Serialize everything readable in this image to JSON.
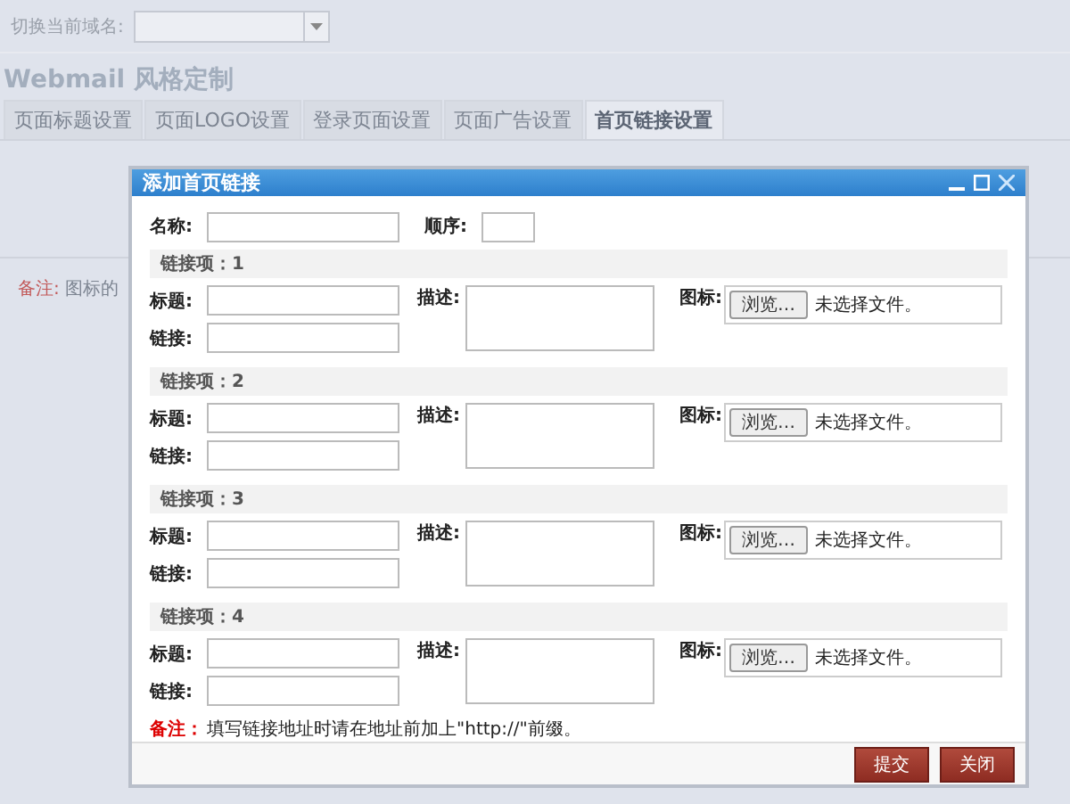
{
  "page": {
    "domain_label": "切换当前域名:",
    "title": "Webmail 风格定制",
    "tabs": [
      {
        "label": "页面标题设置",
        "selected": false
      },
      {
        "label": "页面LOGO设置",
        "selected": false
      },
      {
        "label": "登录页面设置",
        "selected": false
      },
      {
        "label": "页面广告设置",
        "selected": false
      },
      {
        "label": "首页链接设置",
        "selected": true
      }
    ],
    "note": {
      "label": "备注:",
      "text": "图标的"
    }
  },
  "dialog": {
    "title": "添加首页链接",
    "name_label": "名称:",
    "order_label": "顺序:",
    "groups": [
      {
        "heading": "链接项：1",
        "title_label": "标题:",
        "link_label": "链接:",
        "desc_label": "描述:",
        "icon_label": "图标:",
        "browse": "浏览…",
        "file_status": "未选择文件。"
      },
      {
        "heading": "链接项：2",
        "title_label": "标题:",
        "link_label": "链接:",
        "desc_label": "描述:",
        "icon_label": "图标:",
        "browse": "浏览…",
        "file_status": "未选择文件。"
      },
      {
        "heading": "链接项：3",
        "title_label": "标题:",
        "link_label": "链接:",
        "desc_label": "描述:",
        "icon_label": "图标:",
        "browse": "浏览…",
        "file_status": "未选择文件。"
      },
      {
        "heading": "链接项：4",
        "title_label": "标题:",
        "link_label": "链接:",
        "desc_label": "描述:",
        "icon_label": "图标:",
        "browse": "浏览…",
        "file_status": "未选择文件。"
      }
    ],
    "note": {
      "label": "备注：",
      "text": "填写链接地址时请在地址前加上\"http://\"前缀。"
    },
    "buttons": [
      "提交",
      "关闭"
    ]
  }
}
